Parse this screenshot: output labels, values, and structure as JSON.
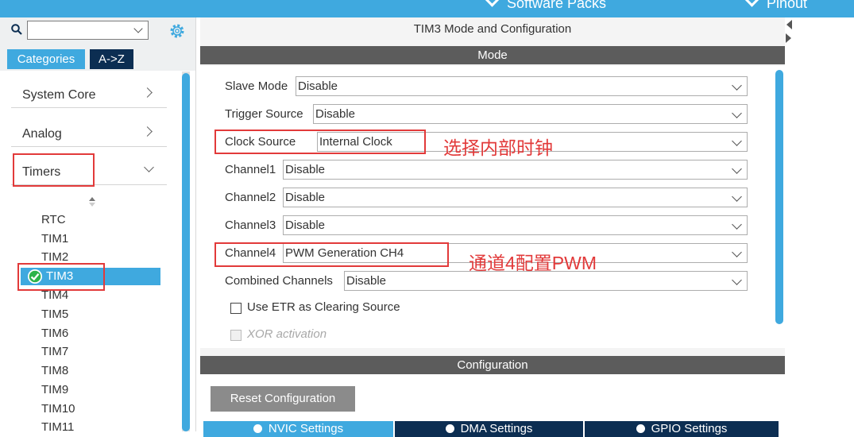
{
  "topbar": {
    "menus": [
      "Software Packs",
      "Pinout"
    ],
    "color": "#3fa9df"
  },
  "left": {
    "search": {
      "value": "",
      "placeholder": ""
    },
    "tabs": [
      "Categories",
      "A->Z"
    ],
    "categories": [
      {
        "label": "System Core",
        "expanded": false
      },
      {
        "label": "Analog",
        "expanded": false
      },
      {
        "label": "Timers",
        "expanded": true
      }
    ],
    "timers": [
      "RTC",
      "TIM1",
      "TIM2",
      "TIM3",
      "TIM4",
      "TIM5",
      "TIM6",
      "TIM7",
      "TIM8",
      "TIM9",
      "TIM10",
      "TIM11"
    ],
    "selected_timer": "TIM3"
  },
  "main": {
    "title": "TIM3 Mode and Configuration",
    "mode_header": "Mode",
    "fields": [
      {
        "label": "Slave Mode",
        "value": "Disable"
      },
      {
        "label": "Trigger Source",
        "value": "Disable"
      },
      {
        "label": "Clock Source",
        "value": "Internal Clock"
      },
      {
        "label": "Channel1",
        "value": "Disable"
      },
      {
        "label": "Channel2",
        "value": "Disable"
      },
      {
        "label": "Channel3",
        "value": "Disable"
      },
      {
        "label": "Channel4",
        "value": "PWM Generation CH4"
      },
      {
        "label": "Combined Channels",
        "value": "Disable"
      }
    ],
    "checkboxes": [
      {
        "label": "Use ETR as Clearing Source",
        "checked": false,
        "enabled": true
      },
      {
        "label": "XOR activation",
        "checked": false,
        "enabled": false
      }
    ],
    "annotations": [
      "选择内部时钟",
      "通道4配置PWM"
    ],
    "config_header": "Configuration",
    "reset_label": "Reset Configuration",
    "settings_tabs": [
      "NVIC Settings",
      "DMA Settings",
      "GPIO Settings"
    ]
  },
  "colors": {
    "accent": "#3fa9df",
    "dark_tab": "#0c2e52",
    "header_bar": "#5c5c5c",
    "annotation": "#e23a3a"
  }
}
